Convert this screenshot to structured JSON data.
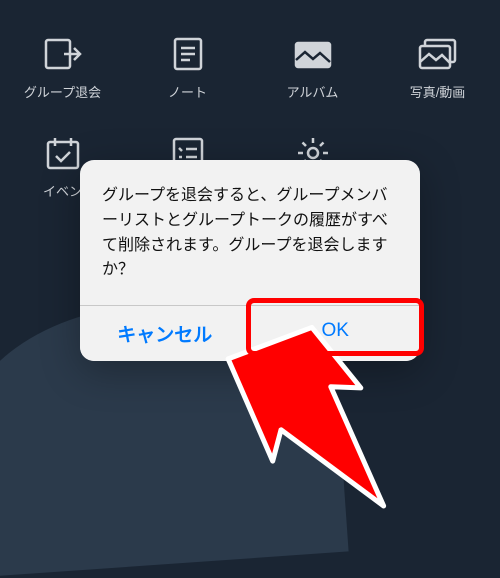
{
  "menu": {
    "items": [
      {
        "label": "グループ退会",
        "icon": "leave-group-icon"
      },
      {
        "label": "ノート",
        "icon": "note-icon"
      },
      {
        "label": "アルバム",
        "icon": "album-icon"
      },
      {
        "label": "写真/動画",
        "icon": "photo-video-icon"
      },
      {
        "label": "イベン",
        "icon": "event-icon"
      },
      {
        "label": "",
        "icon": "list-check-icon"
      },
      {
        "label": "",
        "icon": "settings-icon"
      },
      {
        "label": "",
        "icon": ""
      }
    ]
  },
  "dialog": {
    "message": "グループを退会すると、グループメンバーリストとグループトークの履歴がすべて削除されます。グループを退会しますか？",
    "cancel_label": "キャンセル",
    "ok_label": "OK"
  }
}
